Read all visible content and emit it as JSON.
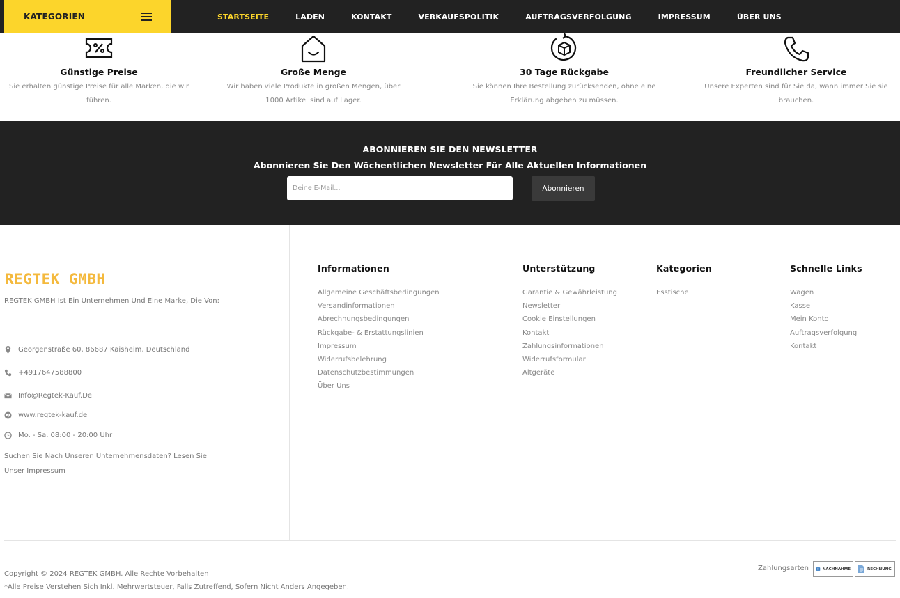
{
  "nav": {
    "categories_label": "KATEGORIEN",
    "items": [
      {
        "label": "STARTSEITE",
        "active": true
      },
      {
        "label": "LADEN"
      },
      {
        "label": "KONTAKT"
      },
      {
        "label": "VERKAUFSPOLITIK"
      },
      {
        "label": "AUFTRAGSVERFOLGUNG"
      },
      {
        "label": "IMPRESSUM"
      },
      {
        "label": "ÜBER UNS"
      }
    ],
    "accent_color": "#fcd52b"
  },
  "features": [
    {
      "icon": "discount-ticket-icon",
      "title": "Günstige Preise",
      "desc": "Sie erhalten günstige Preise für alle Marken, die wir führen."
    },
    {
      "icon": "box-smile-icon",
      "title": "Große Menge",
      "desc": "Wir haben viele Produkte in großen Mengen, über 1000 Artikel sind auf Lager."
    },
    {
      "icon": "return-box-icon",
      "title": "30 Tage Rückgabe",
      "desc": "Sie können Ihre Bestellung zurücksenden, ohne eine Erklärung abgeben zu müssen."
    },
    {
      "icon": "phone-icon",
      "title": "Freundlicher Service",
      "desc": "Unsere Experten sind für Sie da, wann immer Sie sie brauchen."
    }
  ],
  "newsletter": {
    "title": "ABONNIEREN SIE DEN NEWSLETTER",
    "subtitle": "Abonnieren Sie Den Wöchentlichen Newsletter Für Alle Aktuellen Informationen",
    "placeholder": "Deine E-Mail...",
    "button": "Abonnieren"
  },
  "company": {
    "name": "REGTEK GMBH",
    "desc": "REGTEK GMBH Ist Ein Unternehmen Und Eine Marke, Die Von:",
    "address": "Georgenstraße 60, 86687 Kaisheim, Deutschland",
    "phone": "+4917647588800",
    "email": "Info@Regtek-Kauf.De",
    "website": "www.regtek-kauf.de",
    "hours": "Mo. - Sa. 08:00 - 20:00 Uhr",
    "note": "Suchen Sie Nach Unseren Unternehmensdaten? Lesen Sie Unser Impressum",
    "brand_color": "#f4b93d"
  },
  "footer_columns": {
    "informationen": {
      "title": "Informationen",
      "links": [
        "Allgemeine Geschäftsbedingungen",
        "Versandinformationen",
        "Abrechnungsbedingungen",
        "Rückgabe- & Erstattungslinien",
        "Impressum",
        "Widerrufsbelehrung",
        "Datenschutzbestimmungen",
        "Über Uns"
      ]
    },
    "unterstuetzung": {
      "title": "Unterstützung",
      "links": [
        "Garantie & Gewährleistung",
        "Newsletter",
        "Cookie Einstellungen",
        "Kontakt",
        "Zahlungsinformationen",
        "Widerrufsformular",
        "Altgeräte"
      ]
    },
    "kategorien": {
      "title": "Kategorien",
      "links": [
        "Esstische"
      ]
    },
    "schnelle_links": {
      "title": "Schnelle Links",
      "links": [
        "Wagen",
        "Kasse",
        "Mein Konto",
        "Auftragsverfolgung",
        "Kontakt"
      ]
    }
  },
  "bottom": {
    "copyright": "Copyright © 2024 REGTEK GMBH. Alle Rechte Vorbehalten",
    "vat_note": "*Alle Preise Verstehen Sich Inkl. Mehrwertsteuer, Falls Zutreffend, Sofern Nicht Anders Angegeben.",
    "payment_label": "Zahlungsarten",
    "payment_methods": [
      {
        "icon": "cash-on-delivery-icon",
        "label": "NACHNAHME"
      },
      {
        "icon": "invoice-icon",
        "label": "RECHNUNG"
      }
    ]
  }
}
